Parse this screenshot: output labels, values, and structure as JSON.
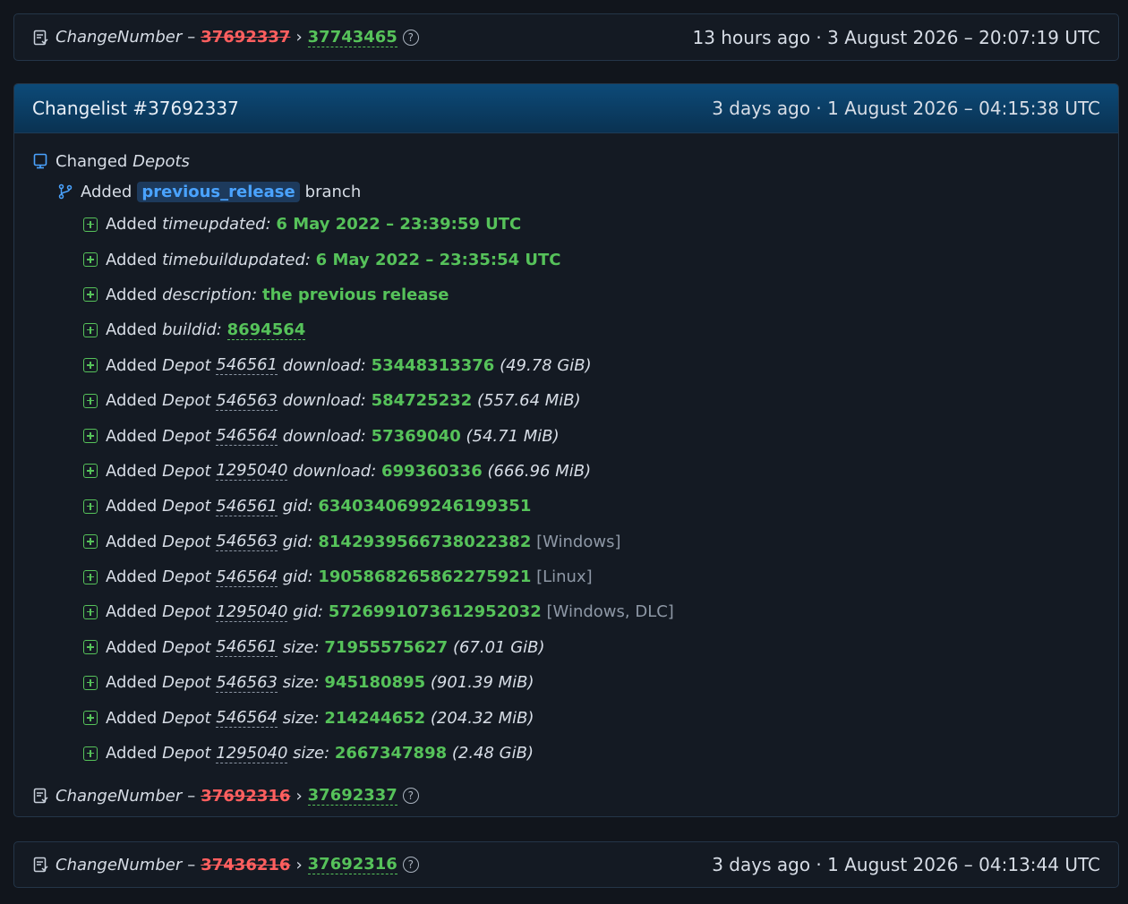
{
  "top": {
    "label": "ChangeNumber",
    "dash": "–",
    "old": "37692337",
    "arrow": "›",
    "new": "37743465",
    "help": "?",
    "timestamp": "13 hours ago · 3 August 2026 – 20:07:19 UTC"
  },
  "changelist": {
    "title": "Changelist #37692337",
    "timestamp": "3 days ago · 1 August 2026 – 04:15:38 UTC",
    "changed": "Changed",
    "depots": "Depots",
    "branch_added": "Added",
    "branch_name": "previous_release",
    "branch_word": "branch",
    "items": [
      {
        "a": "Added",
        "k": "timeupdated:",
        "v": "6 May 2022 – 23:39:59 UTC"
      },
      {
        "a": "Added",
        "k": "timebuildupdated:",
        "v": "6 May 2022 – 23:35:54 UTC"
      },
      {
        "a": "Added",
        "k": "description:",
        "v": "the previous release"
      },
      {
        "a": "Added",
        "k": "buildid:",
        "v": "8694564"
      },
      {
        "a": "Added",
        "p": "Depot",
        "d": "546561",
        "k": "download:",
        "v": "53448313376",
        "x": "(49.78 GiB)"
      },
      {
        "a": "Added",
        "p": "Depot",
        "d": "546563",
        "k": "download:",
        "v": "584725232",
        "x": "(557.64 MiB)"
      },
      {
        "a": "Added",
        "p": "Depot",
        "d": "546564",
        "k": "download:",
        "v": "57369040",
        "x": "(54.71 MiB)"
      },
      {
        "a": "Added",
        "p": "Depot",
        "d": "1295040",
        "k": "download:",
        "v": "699360336",
        "x": "(666.96 MiB)"
      },
      {
        "a": "Added",
        "p": "Depot",
        "d": "546561",
        "k": "gid:",
        "v": "6340340699246199351"
      },
      {
        "a": "Added",
        "p": "Depot",
        "d": "546563",
        "k": "gid:",
        "v": "8142939566738022382",
        "m": "[Windows]"
      },
      {
        "a": "Added",
        "p": "Depot",
        "d": "546564",
        "k": "gid:",
        "v": "1905868265862275921",
        "m": "[Linux]"
      },
      {
        "a": "Added",
        "p": "Depot",
        "d": "1295040",
        "k": "gid:",
        "v": "5726991073612952032",
        "m": "[Windows, DLC]"
      },
      {
        "a": "Added",
        "p": "Depot",
        "d": "546561",
        "k": "size:",
        "v": "71955575627",
        "x": "(67.01 GiB)"
      },
      {
        "a": "Added",
        "p": "Depot",
        "d": "546563",
        "k": "size:",
        "v": "945180895",
        "x": "(901.39 MiB)"
      },
      {
        "a": "Added",
        "p": "Depot",
        "d": "546564",
        "k": "size:",
        "v": "214244652",
        "x": "(204.32 MiB)"
      },
      {
        "a": "Added",
        "p": "Depot",
        "d": "1295040",
        "k": "size:",
        "v": "2667347898",
        "x": "(2.48 GiB)"
      }
    ],
    "footer": {
      "label": "ChangeNumber",
      "dash": "–",
      "old": "37692316",
      "arrow": "›",
      "new": "37692337",
      "help": "?"
    }
  },
  "bottom": {
    "label": "ChangeNumber",
    "dash": "–",
    "old": "37436216",
    "arrow": "›",
    "new": "37692316",
    "help": "?",
    "timestamp": "3 days ago · 1 August 2026 – 04:13:44 UTC"
  },
  "colors": {
    "added": "#56c25a",
    "removed": "#ff5f5f",
    "header": "#0c4a78",
    "link": "#4aa3ff"
  }
}
